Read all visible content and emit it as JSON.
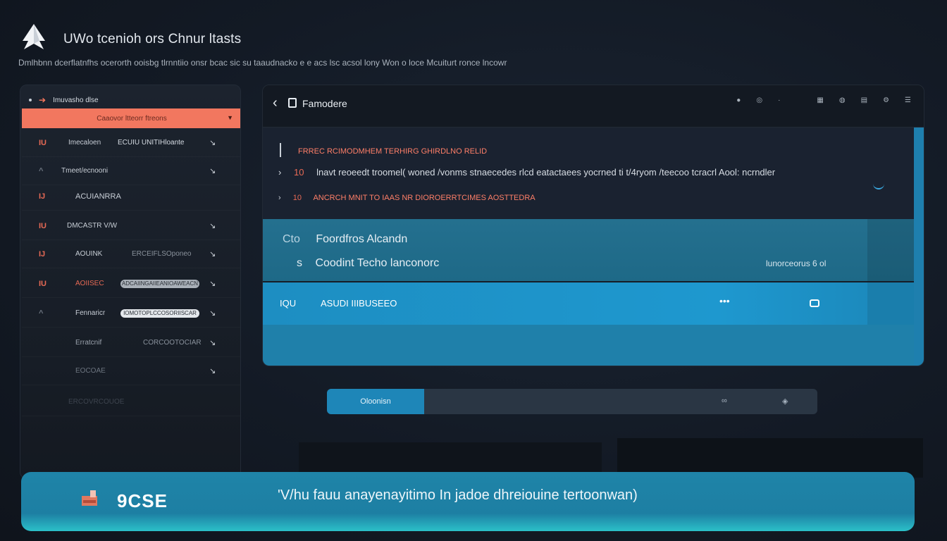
{
  "header": {
    "title": "UWo tcenioh ors Chnur ltasts",
    "subtitle": "Dmlhbnn dcerflatnfhs ocerorth ooisbg tlrnntiio onsr bcac sic su taaudnacko e e acs lsc acsol lony Won o loce Mcuiturt ronce lncowr"
  },
  "sidebar": {
    "header_label": "Imuvasho dlse",
    "active_item": "Caaovor ltteorr ftreons",
    "items": [
      {
        "num": "IU",
        "label": "Imecaloen",
        "extra": "ECUIU UNITIHloante"
      },
      {
        "num": "^",
        "label": "Tmeet/ecnooni",
        "extra": ""
      },
      {
        "num": "IJ",
        "label": "ACUIANRRA",
        "extra": ""
      },
      {
        "num": "IU",
        "label": "DMCASTR V/W",
        "extra": ""
      },
      {
        "num": "IJ",
        "label": "AOUINK",
        "extra": "ERCEIFLSOponeo"
      },
      {
        "num": "IU",
        "label": "AOIISEC",
        "pill": "ADCAIINGAIIEANIOAWEACN"
      },
      {
        "num": "",
        "label": "Fennaricr",
        "pill": "IOMOTOPLCCOSORIISCAR"
      },
      {
        "num": "",
        "label": "Erratcnif",
        "extra": "CORCOOTOCIAR"
      },
      {
        "num": "",
        "label": "EOCOAE",
        "extra": ""
      },
      {
        "num": "",
        "label": "ERCOVRCOUOE",
        "extra": ""
      }
    ]
  },
  "main": {
    "title": "Famodere",
    "code": {
      "line1": "FRREC RCIMODMHEM TERHIRG GHIRDLNO RELID",
      "line2_num": "10",
      "line2": "lnavt reoeedt troomel( woned /vonms stnaecedes rlcd eatactaees yocrned ti t/4ryom /teecoo tcracrl Aool: ncrndler",
      "line3_num": "10",
      "line3": "ANCRCH MNIT TO IAAS NR DIOROERRTCIMES AOSTTEDRA"
    },
    "selection": {
      "prefix": "Cto",
      "line1": "Foordfros Alcandn",
      "line2_prefix": "s",
      "line2": "Coodint Techo lanconorc",
      "meta": "lunorceorus 6 ol"
    },
    "active_row": {
      "num": "IQU",
      "label": "ASUDI IIIBUSEEO",
      "dots": "•••"
    }
  },
  "toolbar": {
    "button_label": "Oloonisn"
  },
  "banner": {
    "code": "9CSE",
    "message": "'V/hu fauu anayenayitimo In jadoe dhreiouine tertoonwan)"
  },
  "colors": {
    "accent": "#1e98cf",
    "coral": "#f2775f",
    "background": "#131a25"
  }
}
